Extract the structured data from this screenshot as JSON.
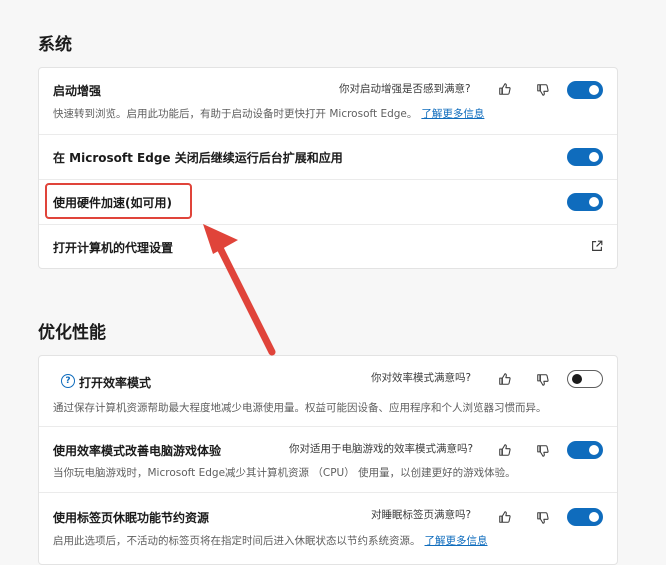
{
  "system": {
    "title": "系统",
    "startup_boost": {
      "title": "启动增强",
      "feedback_question": "你对启动增强是否感到满意?",
      "desc": "快速转到浏览。启用此功能后，有助于启动设备时更快打开 Microsoft Edge。",
      "learn_more": "了解更多信息",
      "enabled": true
    },
    "background_apps": {
      "title": "在 Microsoft Edge 关闭后继续运行后台扩展和应用",
      "enabled": true
    },
    "hardware_accel": {
      "title": "使用硬件加速(如可用)",
      "enabled": true
    },
    "proxy": {
      "title": "打开计算机的代理设置"
    }
  },
  "performance": {
    "title": "优化性能",
    "efficiency_mode": {
      "title": "打开效率模式",
      "feedback_question": "你对效率模式满意吗?",
      "desc": "通过保存计算机资源帮助最大程度地减少电源使用量。权益可能因设备、应用程序和个人浏览器习惯而异。",
      "enabled": false
    },
    "gaming": {
      "title": "使用效率模式改善电脑游戏体验",
      "feedback_question": "你对适用于电脑游戏的效率模式满意吗?",
      "desc": "当你玩电脑游戏时，Microsoft Edge减少其计算机资源 （CPU） 使用量，以创建更好的游戏体验。",
      "enabled": true
    },
    "sleeping_tabs": {
      "title": "使用标签页休眠功能节约资源",
      "feedback_question": "对睡眠标签页满意吗?",
      "desc": "启用此选项后，不活动的标签页将在指定时间后进入休眠状态以节约系统资源。",
      "learn_more": "了解更多信息",
      "enabled": true
    }
  },
  "colors": {
    "accent": "#0f6cbd",
    "annotation": "#e0443a"
  }
}
